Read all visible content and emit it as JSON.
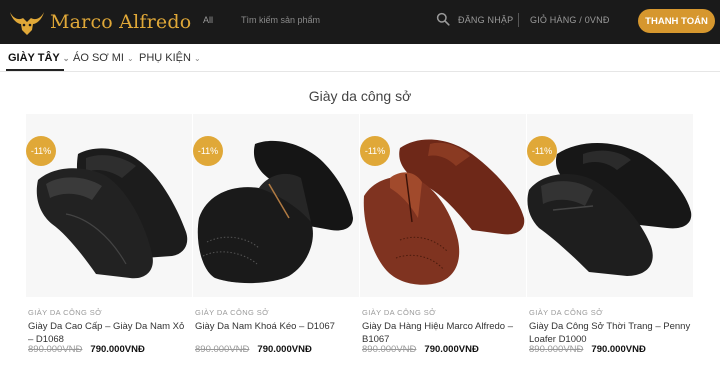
{
  "header": {
    "logo_text": "Marco Alfredo",
    "category_select": "All",
    "search_placeholder": "Tìm kiếm sản phẩm",
    "login_label": "ĐĂNG NHẬP",
    "cart_label": "GIỎ HÀNG / 0VNĐ",
    "checkout_label": "THANH TOÁN",
    "brand_color": "#e0a838"
  },
  "nav": {
    "items": [
      {
        "label": "GIÀY TÂY",
        "active": true
      },
      {
        "label": "ÁO SƠ MI",
        "active": false
      },
      {
        "label": "PHỤ KIỆN",
        "active": false
      }
    ]
  },
  "section": {
    "title": "Giày da công sở"
  },
  "products": [
    {
      "badge": "-11%",
      "category": "GIÀY DA CÔNG SỞ",
      "name": "Giày Da Cao Cấp – Giày Da Nam Xỏ – D1068",
      "old_price": "890.000VNĐ",
      "new_price": "790.000VNĐ",
      "shoe_color": "#1c1c1c",
      "icon": "loafer-shoe-image"
    },
    {
      "badge": "-11%",
      "category": "GIÀY DA CÔNG SỞ",
      "name": "Giày Da Nam Khoá Kéo – D1067",
      "old_price": "890.000VNĐ",
      "new_price": "790.000VNĐ",
      "shoe_color": "#151515",
      "icon": "zip-brogue-shoe-image"
    },
    {
      "badge": "-11%",
      "category": "GIÀY DA CÔNG SỞ",
      "name": "Giày Da Hàng Hiệu Marco Alfredo – B1067",
      "old_price": "890.000VNĐ",
      "new_price": "790.000VNĐ",
      "shoe_color": "#7a2e1c",
      "icon": "brown-brogue-shoe-image"
    },
    {
      "badge": "-11%",
      "category": "GIÀY DA CÔNG SỞ",
      "name": "Giày Da Công Sở Thời Trang – Penny Loafer D1000",
      "old_price": "890.000VNĐ",
      "new_price": "790.000VNĐ",
      "shoe_color": "#171717",
      "icon": "penny-loafer-shoe-image"
    }
  ]
}
